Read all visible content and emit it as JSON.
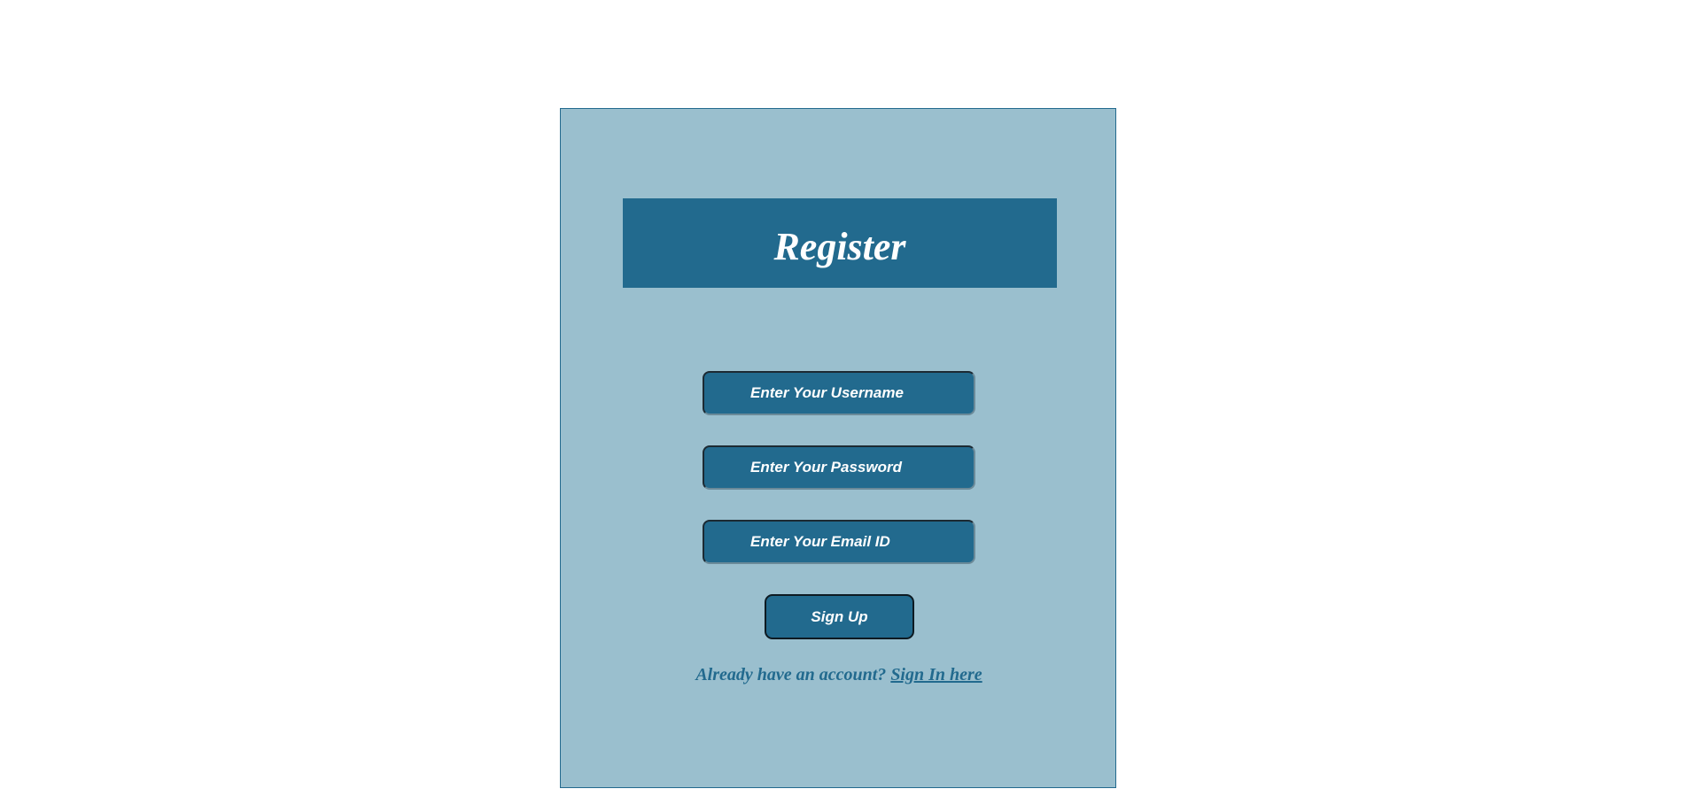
{
  "register": {
    "title": "Register",
    "fields": {
      "username_placeholder": "Enter Your Username",
      "password_placeholder": "Enter Your Password",
      "email_placeholder": "Enter Your Email ID"
    },
    "signup_label": "Sign Up",
    "signin_prompt": "Already have an account?",
    "signin_link": "Sign In here"
  },
  "colors": {
    "card_background": "#9abfce",
    "primary": "#226a8e",
    "text_on_primary": "#ffffff"
  }
}
